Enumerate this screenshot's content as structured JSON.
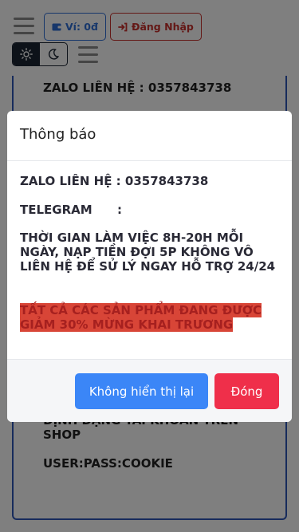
{
  "header": {
    "wallet_label": "Ví: 0đ",
    "login_label": "Đăng Nhập"
  },
  "background": {
    "lines": [
      "ZALO LIÊN HỆ : 0357843738",
      "ĐỊNH DẠNG TÀI KHOẢN TRÊN SHOP",
      "USER:PASS:COOKIE"
    ]
  },
  "modal": {
    "title": "Thông báo",
    "zalo": "ZALO LIÊN HỆ : 0357843738",
    "telegram": "TELEGRAM      :",
    "hours": "THỜI GIAN LÀM VIỆC 8H-20H MỖI NGÀY, NẠP TIỀN ĐỢI 5P KHÔNG VÔ LIÊN HỆ ĐỂ SỬ LÝ NGAY HỖ TRỢ 24/24",
    "promo": "TẤT CẢ CÁC SẢN PHẨM ĐANG ĐƯỢC GIẢM 30% MỪNG KHAI TRƯƠNG",
    "hide_button": "Không hiển thị lại",
    "close_button": "Đóng"
  },
  "colors": {
    "primary": "#3b86f7",
    "danger": "#ef2f4a",
    "promo_bg": "#d84537",
    "wallet_border": "#2f6fd6",
    "login_border": "#c9302c"
  },
  "icons": [
    "hamburger-icon",
    "wallet-icon",
    "login-icon",
    "sun-icon",
    "moon-icon",
    "menu-icon"
  ]
}
